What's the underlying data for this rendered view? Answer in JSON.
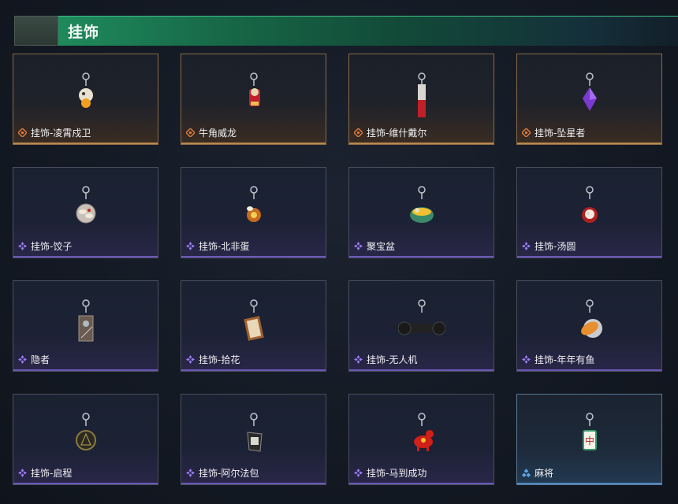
{
  "header": {
    "title": "挂饰"
  },
  "items": [
    {
      "name": "挂饰-凌霄戍卫",
      "rarity": "gold",
      "icon": "chick-charm-icon"
    },
    {
      "name": "牛角威龙",
      "rarity": "gold",
      "icon": "red-mascot-charm-icon"
    },
    {
      "name": "挂饰-维什戴尔",
      "rarity": "gold",
      "icon": "red-tag-charm-icon"
    },
    {
      "name": "挂饰-坠星者",
      "rarity": "gold",
      "icon": "purple-crystal-charm-icon"
    },
    {
      "name": "挂饰-饺子",
      "rarity": "purple",
      "icon": "dumpling-plate-charm-icon"
    },
    {
      "name": "挂饰-北非蛋",
      "rarity": "purple",
      "icon": "egg-dish-charm-icon"
    },
    {
      "name": "聚宝盆",
      "rarity": "purple",
      "icon": "treasure-bowl-charm-icon"
    },
    {
      "name": "挂饰-汤圆",
      "rarity": "purple",
      "icon": "tangyuan-bowl-charm-icon"
    },
    {
      "name": "隐者",
      "rarity": "purple",
      "icon": "card-charm-icon"
    },
    {
      "name": "挂饰-拾花",
      "rarity": "purple",
      "icon": "flower-card-charm-icon"
    },
    {
      "name": "挂饰-无人机",
      "rarity": "purple",
      "icon": "drone-charm-icon"
    },
    {
      "name": "挂饰-年年有鱼",
      "rarity": "purple",
      "icon": "fish-plate-charm-icon"
    },
    {
      "name": "挂饰-启程",
      "rarity": "purple",
      "icon": "medal-charm-icon"
    },
    {
      "name": "挂饰-阿尔法包",
      "rarity": "purple",
      "icon": "bag-charm-icon"
    },
    {
      "name": "挂饰-马到成功",
      "rarity": "purple",
      "icon": "horse-charm-icon"
    },
    {
      "name": "麻将",
      "rarity": "blue",
      "icon": "mahjong-tile-charm-icon"
    }
  ],
  "colors": {
    "gold": "#e07a3a",
    "purple": "#9a7cf0",
    "blue": "#5aa6e8"
  }
}
